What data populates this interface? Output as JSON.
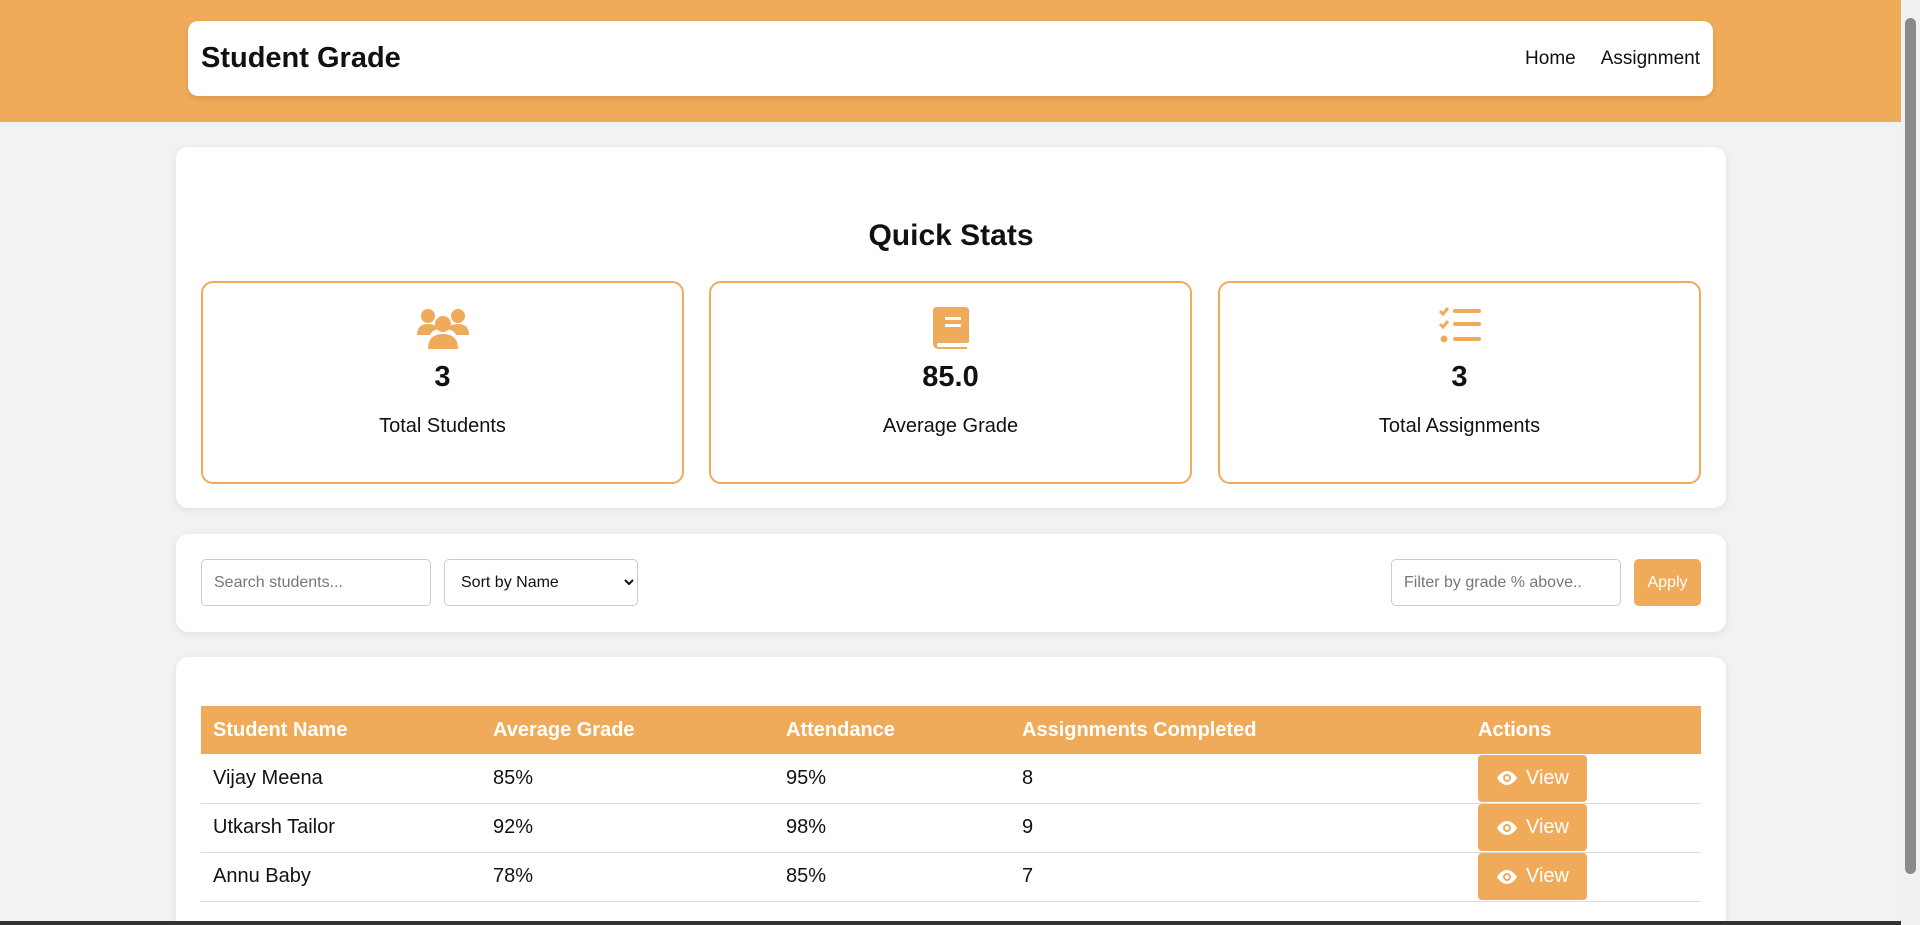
{
  "header": {
    "brand": "Student Grade",
    "nav": [
      "Home",
      "Assignment"
    ]
  },
  "stats": {
    "title": "Quick Stats",
    "items": [
      {
        "icon": "users-icon",
        "value": "3",
        "label": "Total Students"
      },
      {
        "icon": "book-icon",
        "value": "85.0",
        "label": "Average Grade"
      },
      {
        "icon": "tasks-icon",
        "value": "3",
        "label": "Total Assignments"
      }
    ]
  },
  "filters": {
    "search_placeholder": "Search students...",
    "sort_selected": "Sort by Name",
    "grade_placeholder": "Filter by grade % above..",
    "apply_label": "Apply"
  },
  "table": {
    "headers": [
      "Student Name",
      "Average Grade",
      "Attendance",
      "Assignments Completed",
      "Actions"
    ],
    "rows": [
      {
        "name": "Vijay Meena",
        "grade": "85%",
        "attendance": "95%",
        "completed": "8",
        "action": "View"
      },
      {
        "name": "Utkarsh Tailor",
        "grade": "92%",
        "attendance": "98%",
        "completed": "9",
        "action": "View"
      },
      {
        "name": "Annu Baby",
        "grade": "78%",
        "attendance": "85%",
        "completed": "7",
        "action": "View"
      }
    ]
  },
  "colors": {
    "accent": "#f0ab5a",
    "background": "#f2f2f2"
  }
}
